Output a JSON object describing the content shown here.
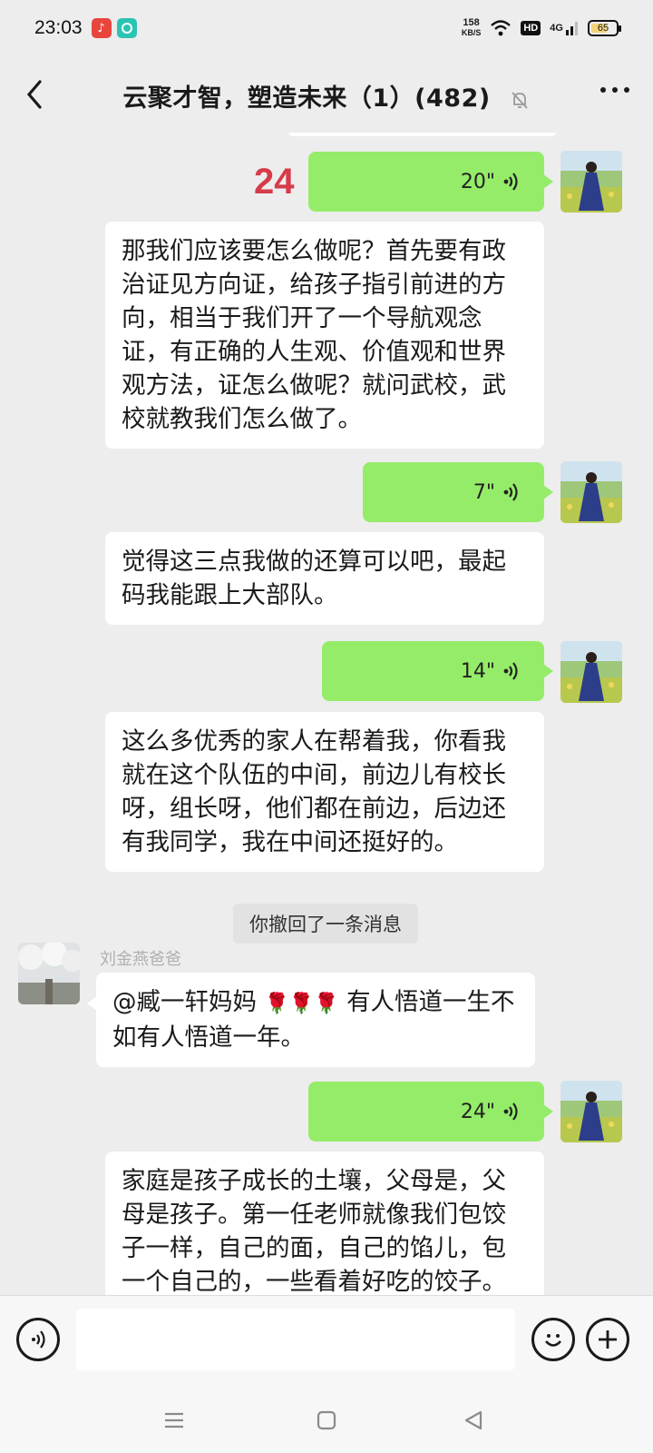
{
  "status_bar": {
    "time": "23:03",
    "net_speed_value": "158",
    "net_speed_unit": "KB/S",
    "hd_label": "HD",
    "signal_label": "4G",
    "battery_level": "65",
    "battery_color": "#f3d37a"
  },
  "nav": {
    "title": "云聚才智，塑造未来（1）(482)",
    "back_icon": "chevron-left-icon",
    "mute_icon": "bell-off-icon",
    "more_icon": "more-dots-icon"
  },
  "messages": {
    "note_number": "24",
    "voice_1": {
      "duration": "20\""
    },
    "text_1": "那我们应该要怎么做呢？首先要有政治证见方向证，给孩子指引前进的方向，相当于我们开了一个导航观念证，有正确的人生观、价值观和世界观方法，证怎么做呢？就问武校，武校就教我们怎么做了。",
    "voice_2": {
      "duration": "7\""
    },
    "text_2": "觉得这三点我做的还算可以吧，最起码我能跟上大部队。",
    "voice_3": {
      "duration": "14\""
    },
    "text_3": "这么多优秀的家人在帮着我，你看我就在这个队伍的中间，前边儿有校长呀，组长呀，他们都在前边，后边还有我同学，我在中间还挺好的。",
    "recall_notice": "你撤回了一条消息",
    "sender_name": "刘金燕爸爸",
    "reply_mention": "@臧一轩妈妈",
    "reply_flowers": "🌹🌹🌹",
    "reply_text": "有人悟道一生不如有人悟道一年。",
    "voice_4": {
      "duration": "24\""
    },
    "text_4": "家庭是孩子成长的土壤，父母是，父母是孩子。第一任老师就像我们包饺子一样，自己的面，自己的馅儿，包一个自己的，一些看着好吃的饺子。"
  },
  "input_bar": {
    "voice_icon": "voice-input-icon",
    "emoji_icon": "emoji-icon",
    "plus_icon": "plus-icon",
    "bubble_color": "#95ec69"
  },
  "system_nav": {
    "menu_icon": "menu-icon",
    "home_icon": "home-square-icon",
    "back_icon": "back-triangle-icon"
  }
}
